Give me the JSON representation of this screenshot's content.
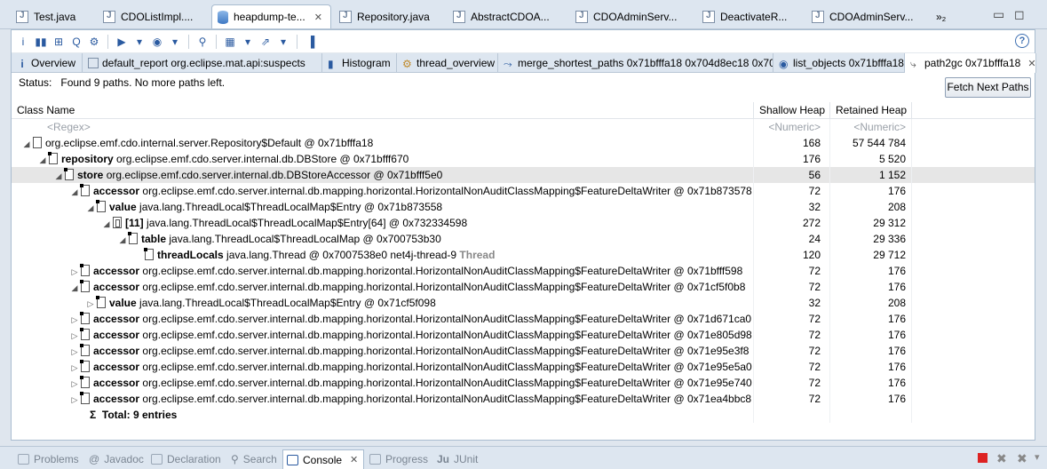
{
  "editor_tabs": [
    {
      "label": "Test.java"
    },
    {
      "label": "CDOListImpl...."
    },
    {
      "label": "heapdump-te..."
    },
    {
      "label": "Repository.java"
    },
    {
      "label": "AbstractCDOA..."
    },
    {
      "label": "CDOAdminServ..."
    },
    {
      "label": "DeactivateR..."
    },
    {
      "label": "CDOAdminServ..."
    }
  ],
  "overflow_tabs": "»₂",
  "sub_tabs": [
    {
      "label": "Overview"
    },
    {
      "label": "default_report  org.eclipse.mat.api:suspects"
    },
    {
      "label": "Histogram"
    },
    {
      "label": "thread_overview"
    },
    {
      "label": "merge_shortest_paths 0x71bfffa18 0x704d8ec18 0x70..."
    },
    {
      "label": "list_objects 0x71bfffa18"
    },
    {
      "label": "path2gc 0x71bfffa18"
    }
  ],
  "status": {
    "label": "Status:",
    "text": "Found 9 paths. No more paths left."
  },
  "fetch_button": "Fetch Next Paths",
  "columns": {
    "name": "Class Name",
    "shallow": "Shallow Heap",
    "retained": "Retained Heap"
  },
  "filter": {
    "name": "<Regex>",
    "shallow": "<Numeric>",
    "retained": "<Numeric>"
  },
  "rows": [
    {
      "field": "",
      "cls": "org.eclipse.emf.cdo.internal.server.Repository$Default @ 0x71bfffa18",
      "extra": "",
      "shallow": "168",
      "retained": "57 544 784"
    },
    {
      "field": "repository",
      "cls": "org.eclipse.emf.cdo.server.internal.db.DBStore @ 0x71bfff670",
      "extra": "",
      "shallow": "176",
      "retained": "5 520"
    },
    {
      "field": "store",
      "cls": "org.eclipse.emf.cdo.server.internal.db.DBStoreAccessor @ 0x71bfff5e0",
      "extra": "",
      "shallow": "56",
      "retained": "1 152"
    },
    {
      "field": "accessor",
      "cls": "org.eclipse.emf.cdo.server.internal.db.mapping.horizontal.HorizontalNonAuditClassMapping$FeatureDeltaWriter @ 0x71b873578",
      "extra": "",
      "shallow": "72",
      "retained": "176"
    },
    {
      "field": "value",
      "cls": "java.lang.ThreadLocal$ThreadLocalMap$Entry @ 0x71b873558",
      "extra": "",
      "shallow": "32",
      "retained": "208"
    },
    {
      "field": "[11]",
      "cls": "java.lang.ThreadLocal$ThreadLocalMap$Entry[64] @ 0x732334598",
      "extra": "",
      "shallow": "272",
      "retained": "29 312"
    },
    {
      "field": "table",
      "cls": "java.lang.ThreadLocal$ThreadLocalMap @ 0x700753b30",
      "extra": "",
      "shallow": "24",
      "retained": "29 336"
    },
    {
      "field": "threadLocals",
      "cls": "java.lang.Thread @ 0x7007538e0  net4j-thread-9",
      "extra": "Thread",
      "shallow": "120",
      "retained": "29 712"
    },
    {
      "field": "accessor",
      "cls": "org.eclipse.emf.cdo.server.internal.db.mapping.horizontal.HorizontalNonAuditClassMapping$FeatureDeltaWriter @ 0x71bfff598",
      "extra": "",
      "shallow": "72",
      "retained": "176"
    },
    {
      "field": "accessor",
      "cls": "org.eclipse.emf.cdo.server.internal.db.mapping.horizontal.HorizontalNonAuditClassMapping$FeatureDeltaWriter @ 0x71cf5f0b8",
      "extra": "",
      "shallow": "72",
      "retained": "176"
    },
    {
      "field": "value",
      "cls": "java.lang.ThreadLocal$ThreadLocalMap$Entry @ 0x71cf5f098",
      "extra": "",
      "shallow": "32",
      "retained": "208"
    },
    {
      "field": "accessor",
      "cls": "org.eclipse.emf.cdo.server.internal.db.mapping.horizontal.HorizontalNonAuditClassMapping$FeatureDeltaWriter @ 0x71d671ca0",
      "extra": "",
      "shallow": "72",
      "retained": "176"
    },
    {
      "field": "accessor",
      "cls": "org.eclipse.emf.cdo.server.internal.db.mapping.horizontal.HorizontalNonAuditClassMapping$FeatureDeltaWriter @ 0x71e805d98",
      "extra": "",
      "shallow": "72",
      "retained": "176"
    },
    {
      "field": "accessor",
      "cls": "org.eclipse.emf.cdo.server.internal.db.mapping.horizontal.HorizontalNonAuditClassMapping$FeatureDeltaWriter @ 0x71e95e3f8",
      "extra": "",
      "shallow": "72",
      "retained": "176"
    },
    {
      "field": "accessor",
      "cls": "org.eclipse.emf.cdo.server.internal.db.mapping.horizontal.HorizontalNonAuditClassMapping$FeatureDeltaWriter @ 0x71e95e5a0",
      "extra": "",
      "shallow": "72",
      "retained": "176"
    },
    {
      "field": "accessor",
      "cls": "org.eclipse.emf.cdo.server.internal.db.mapping.horizontal.HorizontalNonAuditClassMapping$FeatureDeltaWriter @ 0x71e95e740",
      "extra": "",
      "shallow": "72",
      "retained": "176"
    },
    {
      "field": "accessor",
      "cls": "org.eclipse.emf.cdo.server.internal.db.mapping.horizontal.HorizontalNonAuditClassMapping$FeatureDeltaWriter @ 0x71ea4bbc8",
      "extra": "",
      "shallow": "72",
      "retained": "176"
    }
  ],
  "total": {
    "symbol": "Σ",
    "label": "Total: 9 entries"
  },
  "bottom_tabs": [
    {
      "label": "Problems"
    },
    {
      "label": "Javadoc"
    },
    {
      "label": "Declaration"
    },
    {
      "label": "Search"
    },
    {
      "label": "Console"
    },
    {
      "label": "Progress"
    },
    {
      "label": "JUnit"
    }
  ],
  "colors": {
    "selected_row": "#e6e6e6",
    "tab_bar": "#dde6f0",
    "stop": "#dd2222"
  }
}
